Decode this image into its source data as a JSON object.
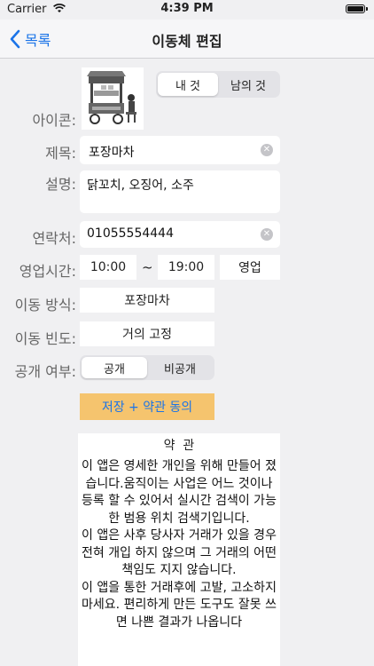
{
  "status": {
    "carrier": "Carrier",
    "time": "4:39 PM"
  },
  "nav": {
    "back_label": "목록",
    "title": "이동체 편집"
  },
  "form": {
    "icon_label": "아이콘:",
    "owner_options": [
      "내 것",
      "남의 것"
    ],
    "title_label": "제목:",
    "title_value": "포장마차",
    "desc_label": "설명:",
    "desc_value": "닭꼬치, 오징어, 소주",
    "contact_label": "연락처:",
    "contact_value": "01055554444",
    "hours_label": "영업시간:",
    "open_time": "10:00",
    "tilde": "~",
    "close_time": "19:00",
    "hours_status": "영업",
    "move_method_label": "이동 방식:",
    "move_method_value": "포장마차",
    "move_freq_label": "이동 빈도:",
    "move_freq_value": "거의 고정",
    "public_label": "공개 여부:",
    "public_options": [
      "공개",
      "비공개"
    ]
  },
  "save_button": "저장 + 약관 동의",
  "terms": {
    "title": "약  관",
    "body": "  이 앱은 영세한 개인을 위해 만들어 졌습니다.움직이는 사업은 어느 것이나 등록 할 수 있어서 실시간 검색이 가능한 범용 위치 검색기입니다.\n  이 앱은 사후 당사자 거래가 있을 경우 전혀 개입 하지 않으며 그 거래의 어떤 책임도 지지 않습니다.\n  이 앱을 통한 거래후에 고발, 고소하지 마세요. 편리하게 만든 도구도 잘못 쓰면 나쁜 결과가 나옵니다"
  },
  "colors": {
    "accent": "#1b74e8",
    "save_button_bg": "#f5c46e",
    "save_button_text": "#1b74e8"
  }
}
